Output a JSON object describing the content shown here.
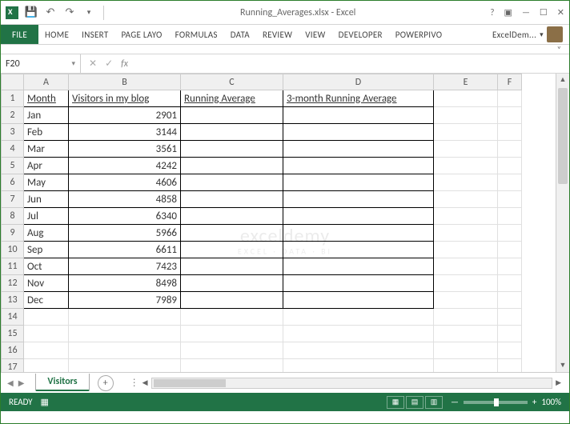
{
  "title": "Running_Averages.xlsx - Excel",
  "ribbon": {
    "file": "FILE",
    "tabs": [
      "HOME",
      "INSERT",
      "PAGE LAYO",
      "FORMULAS",
      "DATA",
      "REVIEW",
      "VIEW",
      "DEVELOPER",
      "POWERPIVO"
    ],
    "user": "ExcelDem..."
  },
  "namebox": "F20",
  "fx": "fx",
  "formula": "",
  "cols": [
    "A",
    "B",
    "C",
    "D",
    "E",
    "F"
  ],
  "headers": {
    "A": "Month",
    "B": "Visitors in my blog",
    "C": "Running Average",
    "D": "3-month Running Average"
  },
  "chart_data": {
    "type": "table",
    "columns": [
      "Month",
      "Visitors in my blog",
      "Running Average",
      "3-month Running Average"
    ],
    "rows": [
      {
        "Month": "Jan",
        "Visitors in my blog": 2901,
        "Running Average": "",
        "3-month Running Average": ""
      },
      {
        "Month": "Feb",
        "Visitors in my blog": 3144,
        "Running Average": "",
        "3-month Running Average": ""
      },
      {
        "Month": "Mar",
        "Visitors in my blog": 3561,
        "Running Average": "",
        "3-month Running Average": ""
      },
      {
        "Month": "Apr",
        "Visitors in my blog": 4242,
        "Running Average": "",
        "3-month Running Average": ""
      },
      {
        "Month": "May",
        "Visitors in my blog": 4606,
        "Running Average": "",
        "3-month Running Average": ""
      },
      {
        "Month": "Jun",
        "Visitors in my blog": 4858,
        "Running Average": "",
        "3-month Running Average": ""
      },
      {
        "Month": "Jul",
        "Visitors in my blog": 6340,
        "Running Average": "",
        "3-month Running Average": ""
      },
      {
        "Month": "Aug",
        "Visitors in my blog": 5966,
        "Running Average": "",
        "3-month Running Average": ""
      },
      {
        "Month": "Sep",
        "Visitors in my blog": 6611,
        "Running Average": "",
        "3-month Running Average": ""
      },
      {
        "Month": "Oct",
        "Visitors in my blog": 7423,
        "Running Average": "",
        "3-month Running Average": ""
      },
      {
        "Month": "Nov",
        "Visitors in my blog": 8498,
        "Running Average": "",
        "3-month Running Average": ""
      },
      {
        "Month": "Dec",
        "Visitors in my blog": 7989,
        "Running Average": "",
        "3-month Running Average": ""
      }
    ]
  },
  "sheet_tab": "Visitors",
  "status": "READY",
  "zoom": "100%",
  "watermark": {
    "main": "exceldemy",
    "sub": "EXCEL · DATA · BI"
  }
}
